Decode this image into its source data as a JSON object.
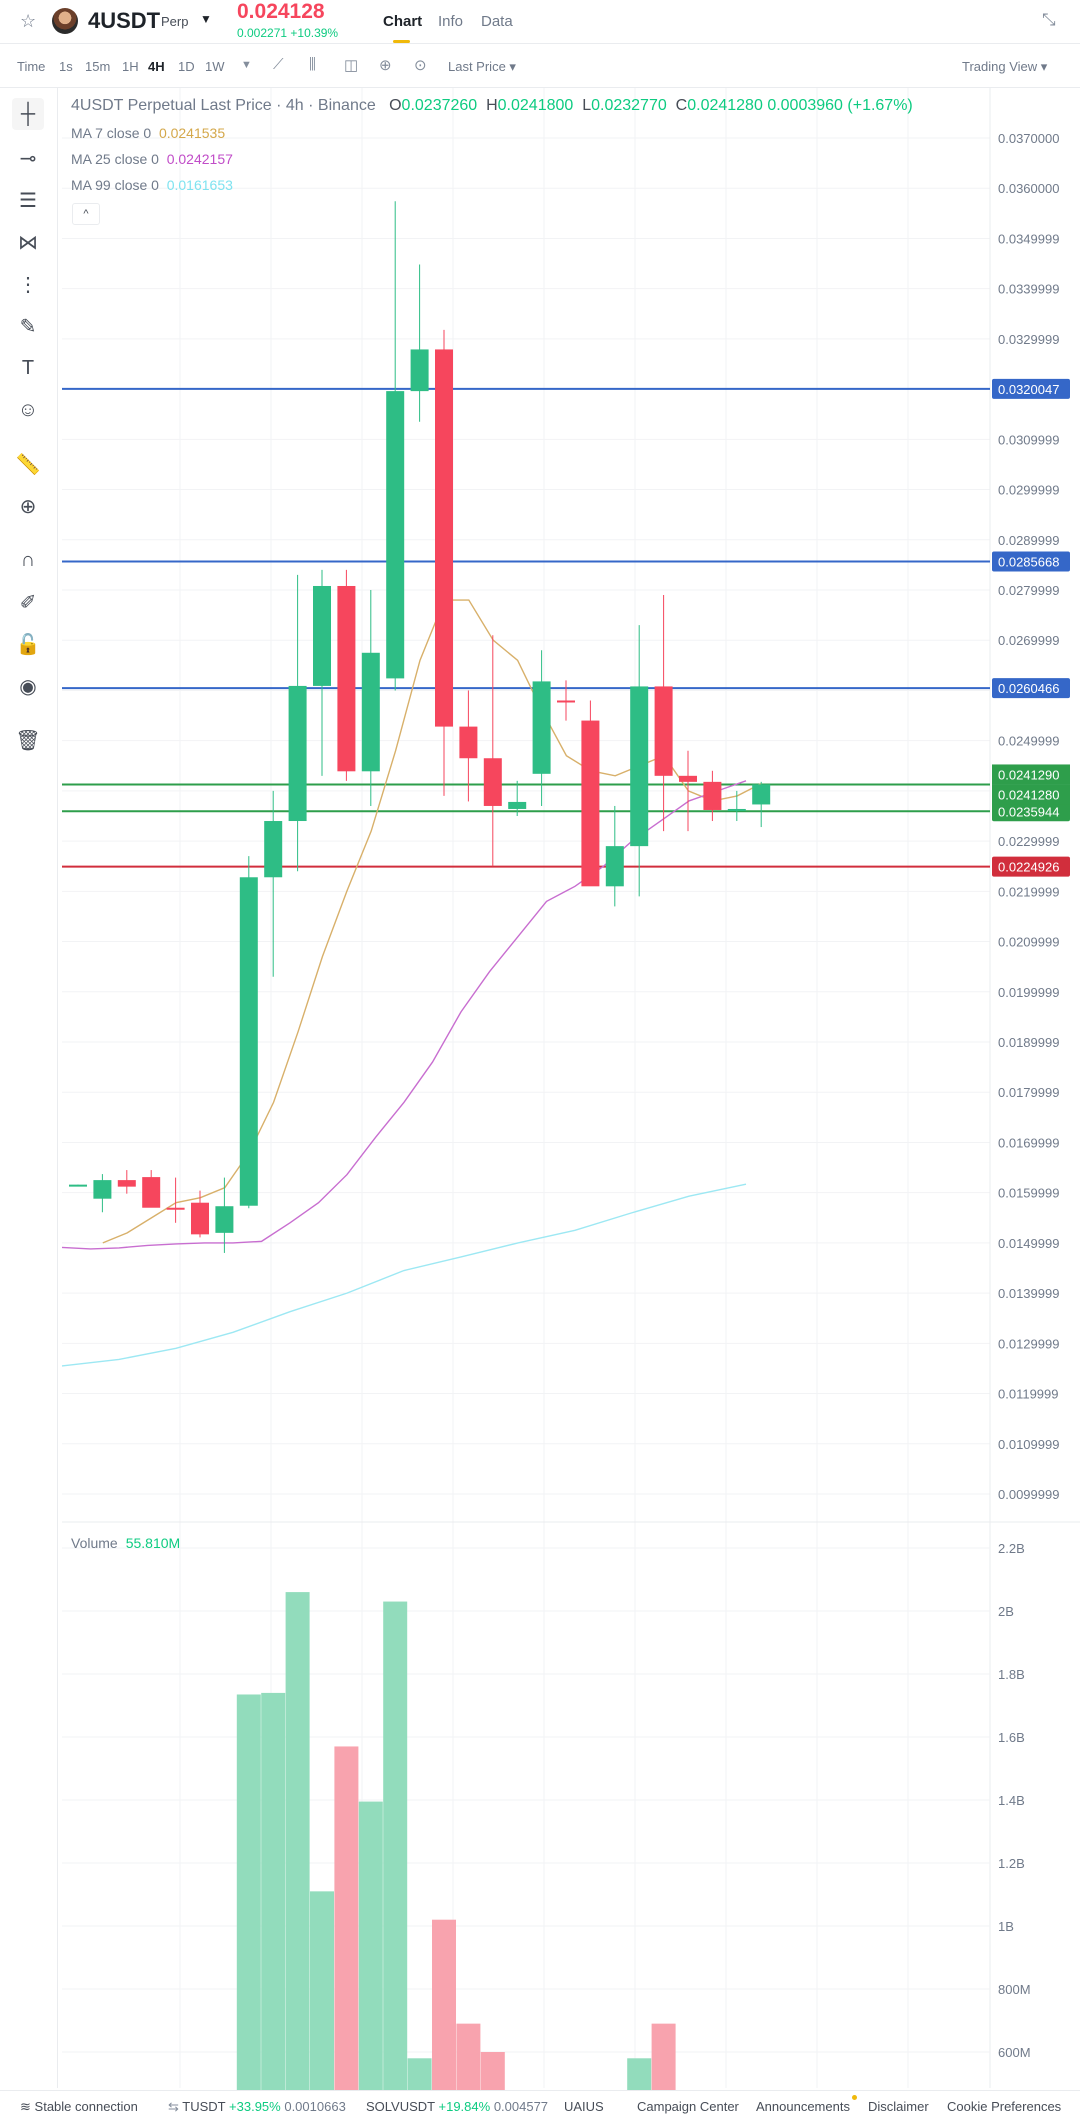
{
  "header": {
    "symbol": "4USDT",
    "contract_type": "Perp",
    "last_price": "0.024128",
    "change": "0.002271 +10.39%",
    "tabs": [
      "Chart",
      "Info",
      "Data"
    ],
    "colors": {
      "down": "#f6465d",
      "up": "#0ecb81",
      "accent": "#f0b90b"
    }
  },
  "toolbar": {
    "time_label": "Time",
    "intervals": [
      "1s",
      "15m",
      "1H",
      "4H",
      "1D",
      "1W"
    ],
    "active_interval": "4H",
    "price_type": "Last Price",
    "view": "Trading View"
  },
  "legend": {
    "title": "4USDT Perpetual Last Price · 4h · Binance",
    "ohlc": {
      "O": "0.0237260",
      "H": "0.0241800",
      "L": "0.0232770",
      "C": "0.0241280",
      "change": "0.0003960 (+1.67%)"
    },
    "ma": [
      {
        "label": "MA 7 close 0",
        "value": "0.0241535",
        "color": "#d4a84b"
      },
      {
        "label": "MA 25 close 0",
        "value": "0.0242157",
        "color": "#c14dc8"
      },
      {
        "label": "MA 99 close 0",
        "value": "0.0161653",
        "color": "#7fe3f0"
      }
    ],
    "collapse": "^"
  },
  "volume_legend": {
    "label": "Volume",
    "value": "55.810M"
  },
  "chart_data": {
    "type": "candlestick",
    "y_range": [
      0.0093,
      0.0377
    ],
    "y_ticks": [
      "0.0370000",
      "0.0360000",
      "0.0349999",
      "0.0339999",
      "0.0329999",
      "0.0320000",
      "0.0309999",
      "0.0299999",
      "0.0289999",
      "0.0279999",
      "0.0269999",
      "0.0259999",
      "0.0249999",
      "0.0239999",
      "0.0229999",
      "0.0219999",
      "0.0209999",
      "0.0199999",
      "0.0189999",
      "0.0179999",
      "0.0169999",
      "0.0159999",
      "0.0149999",
      "0.0139999",
      "0.0129999",
      "0.0119999",
      "0.0109999",
      "0.0099999"
    ],
    "candles": [
      {
        "o": 0.01613,
        "h": 0.01616,
        "l": 0.01613,
        "c": 0.01616
      },
      {
        "o": 0.01588,
        "h": 0.01637,
        "l": 0.01561,
        "c": 0.01625
      },
      {
        "o": 0.01625,
        "h": 0.01645,
        "l": 0.01598,
        "c": 0.01612
      },
      {
        "o": 0.01631,
        "h": 0.01645,
        "l": 0.01594,
        "c": 0.0157
      },
      {
        "o": 0.0157,
        "h": 0.0163,
        "l": 0.0154,
        "c": 0.01566
      },
      {
        "o": 0.0158,
        "h": 0.01604,
        "l": 0.01511,
        "c": 0.01517
      },
      {
        "o": 0.0152,
        "h": 0.0163,
        "l": 0.0148,
        "c": 0.01573
      },
      {
        "o": 0.01574,
        "h": 0.0227,
        "l": 0.01569,
        "c": 0.02228
      },
      {
        "o": 0.02228,
        "h": 0.024,
        "l": 0.0203,
        "c": 0.0234
      },
      {
        "o": 0.0234,
        "h": 0.0283,
        "l": 0.0224,
        "c": 0.02609
      },
      {
        "o": 0.02609,
        "h": 0.0284,
        "l": 0.0243,
        "c": 0.02808
      },
      {
        "o": 0.02808,
        "h": 0.0284,
        "l": 0.0242,
        "c": 0.02439
      },
      {
        "o": 0.02439,
        "h": 0.028,
        "l": 0.0237,
        "c": 0.02675
      },
      {
        "o": 0.02624,
        "h": 0.03574,
        "l": 0.026,
        "c": 0.03196
      },
      {
        "o": 0.03196,
        "h": 0.03448,
        "l": 0.03135,
        "c": 0.03279
      },
      {
        "o": 0.03279,
        "h": 0.03318,
        "l": 0.0239,
        "c": 0.02528
      },
      {
        "o": 0.02528,
        "h": 0.026,
        "l": 0.02379,
        "c": 0.02465
      },
      {
        "o": 0.02465,
        "h": 0.0271,
        "l": 0.0225,
        "c": 0.0237
      },
      {
        "o": 0.02364,
        "h": 0.0242,
        "l": 0.0235,
        "c": 0.02378
      },
      {
        "o": 0.02434,
        "h": 0.0268,
        "l": 0.0237,
        "c": 0.02618
      },
      {
        "o": 0.0258,
        "h": 0.0262,
        "l": 0.0254,
        "c": 0.02579
      },
      {
        "o": 0.0254,
        "h": 0.0258,
        "l": 0.0231,
        "c": 0.0221
      },
      {
        "o": 0.0221,
        "h": 0.0237,
        "l": 0.0217,
        "c": 0.0229
      },
      {
        "o": 0.0229,
        "h": 0.0273,
        "l": 0.0219,
        "c": 0.02608
      },
      {
        "o": 0.02608,
        "h": 0.0279,
        "l": 0.0232,
        "c": 0.0243
      },
      {
        "o": 0.0243,
        "h": 0.0248,
        "l": 0.0232,
        "c": 0.02418
      },
      {
        "o": 0.02418,
        "h": 0.0244,
        "l": 0.0234,
        "c": 0.02362
      },
      {
        "o": 0.02362,
        "h": 0.024,
        "l": 0.0234,
        "c": 0.02364
      },
      {
        "o": 0.02373,
        "h": 0.02418,
        "l": 0.02328,
        "c": 0.02413
      }
    ],
    "ma7": [
      null,
      null,
      0.015,
      0.0152,
      0.0155,
      0.0158,
      0.0159,
      0.0161,
      0.0168,
      0.0178,
      0.0192,
      0.0207,
      0.022,
      0.0232,
      0.0248,
      0.0266,
      0.0278,
      0.0278,
      0.027,
      0.0266,
      0.0256,
      0.0247,
      0.0244,
      0.0243,
      0.0245,
      0.0247,
      0.024,
      0.0238,
      0.0239,
      0.02415
    ],
    "ma25": [
      0.01491,
      0.01488,
      0.0149,
      0.01495,
      0.01498,
      0.015,
      0.015,
      0.01503,
      0.0154,
      0.0158,
      0.01636,
      0.0171,
      0.0178,
      0.0186,
      0.0196,
      0.0204,
      0.0211,
      0.0218,
      0.0221,
      0.0225,
      0.023,
      0.0234,
      0.0238,
      0.024,
      0.0242
    ],
    "ma99": [
      0.01255,
      0.01268,
      0.0129,
      0.01322,
      0.01363,
      0.014,
      0.01445,
      0.01472,
      0.015,
      0.01525,
      0.0156,
      0.01593,
      0.01617
    ],
    "horizontal_lines": [
      {
        "value": 0.0320047,
        "label": "0.0320047",
        "color": "#3567c8"
      },
      {
        "value": 0.0285668,
        "label": "0.0285668",
        "color": "#3567c8"
      },
      {
        "value": 0.0260466,
        "label": "0.0260466",
        "color": "#3567c8"
      },
      {
        "value": 0.024128,
        "label": "0.0241280",
        "color": "#2e9e4b"
      },
      {
        "value": 0.0235944,
        "label": "0.0235944",
        "color": "#2e9e4b"
      },
      {
        "value": 0.0224926,
        "label": "0.0224926",
        "color": "#d12e3c"
      }
    ],
    "price_tags": [
      {
        "value": 0.024129,
        "label": "0.0241290",
        "color": "#2e9e4b",
        "offset": -1
      },
      {
        "value": 0.024128,
        "label": "0.0241280",
        "color": "#2e9e4b",
        "offset": 1
      }
    ],
    "volume": {
      "range": [
        500,
        2200
      ],
      "ticks": [
        "2.2B",
        "2B",
        "1.8B",
        "1.6B",
        "1.4B",
        "1.2B",
        "1B",
        "800M",
        "600M"
      ],
      "tick_values": [
        2200,
        2000,
        1800,
        1600,
        1400,
        1200,
        1000,
        800,
        600
      ],
      "bars": [
        {
          "i": 7,
          "v": 1735,
          "up": true
        },
        {
          "i": 8,
          "v": 1740,
          "up": true
        },
        {
          "i": 9,
          "v": 2060,
          "up": true
        },
        {
          "i": 10,
          "v": 1110,
          "up": true
        },
        {
          "i": 11,
          "v": 1570,
          "up": false
        },
        {
          "i": 12,
          "v": 1395,
          "up": true
        },
        {
          "i": 13,
          "v": 2030,
          "up": true
        },
        {
          "i": 14,
          "v": 580,
          "up": true
        },
        {
          "i": 15,
          "v": 1020,
          "up": false
        },
        {
          "i": 16,
          "v": 690,
          "up": false
        },
        {
          "i": 17,
          "v": 600,
          "up": false
        },
        {
          "i": 23,
          "v": 580,
          "up": true
        },
        {
          "i": 24,
          "v": 690,
          "up": false
        }
      ]
    }
  },
  "footer": {
    "connection": "Stable connection",
    "ticker1_symbol": "TUSDT",
    "ticker1_change": "+33.95%",
    "ticker1_price": "0.0010663",
    "ticker2_symbol": "SOLVUSDT",
    "ticker2_change": "+19.84%",
    "ticker2_price": "0.004577",
    "ticker3_symbol": "UAIUS",
    "links": [
      "Campaign Center",
      "Announcements",
      "Disclaimer",
      "Cookie Preferences"
    ]
  }
}
